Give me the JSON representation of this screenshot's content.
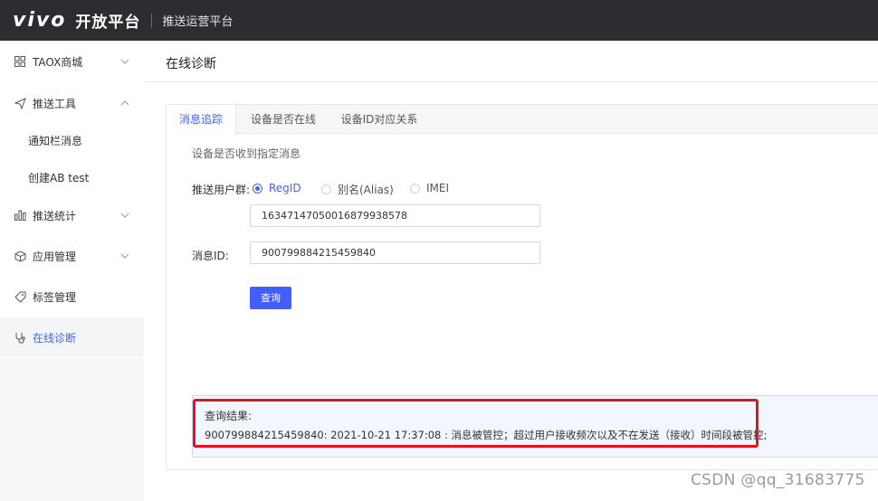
{
  "header": {
    "logo": "vivo",
    "platform": "开放平台",
    "subtitle": "推送运营平台"
  },
  "sidebar": {
    "items": [
      {
        "label": "TAOX商城",
        "icon": "grid-icon"
      },
      {
        "label": "推送工具",
        "icon": "send-icon"
      },
      {
        "label": "通知栏消息"
      },
      {
        "label": "创建AB test"
      },
      {
        "label": "推送统计",
        "icon": "bar-chart-icon"
      },
      {
        "label": "应用管理",
        "icon": "box-icon"
      },
      {
        "label": "标签管理",
        "icon": "tag-icon"
      },
      {
        "label": "在线诊断",
        "icon": "stethoscope-icon"
      }
    ]
  },
  "page": {
    "title": "在线诊断"
  },
  "tabs": [
    {
      "label": "消息追踪"
    },
    {
      "label": "设备是否在线"
    },
    {
      "label": "设备ID对应关系"
    }
  ],
  "form": {
    "hint": "设备是否收到指定消息",
    "user_group_label": "推送用户群:",
    "radio_options": [
      "RegID",
      "别名(Alias)",
      "IMEI"
    ],
    "selected_option": "RegID",
    "regid_value": "16347147050016879938578",
    "message_id_label": "消息ID:",
    "message_id_value": "900799884215459840",
    "query_button": "查询"
  },
  "result": {
    "title": "查询结果:",
    "text": "900799884215459840: 2021-10-21 17:37:08 : 消息被管控；超过用户接收频次以及不在发送（接收）时间段被管控;"
  },
  "watermark": "CSDN @qq_31683775",
  "colors": {
    "accent": "#415fff",
    "topbar": "#2b2d31",
    "highlight_frame": "#e5141c"
  }
}
